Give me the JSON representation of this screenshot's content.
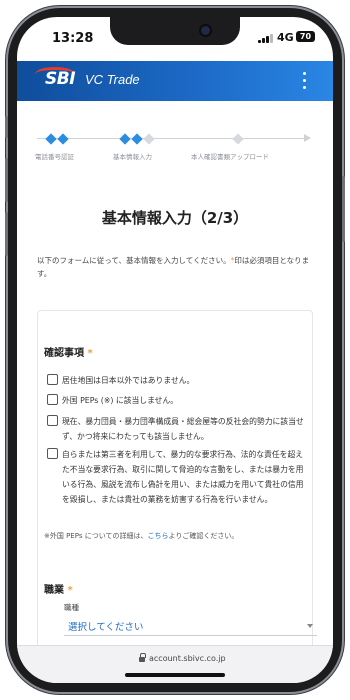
{
  "status_bar": {
    "time": "13:28",
    "network": "4G",
    "battery": "70",
    "signal_icon": "signal-bars-icon"
  },
  "app_bar": {
    "logo_primary": "SBI",
    "logo_secondary": "VC Trade",
    "menu_icon": "more-vertical-icon",
    "colors": {
      "from": "#0f4d9c",
      "to": "#2b86e4",
      "logo_accent": "#e63b2e"
    }
  },
  "stepper": {
    "steps": [
      {
        "label": "電話番号認証",
        "status": "done"
      },
      {
        "label": "基本情報入力",
        "status": "current"
      },
      {
        "label": "本人確認書類アップロード",
        "status": "pending"
      }
    ],
    "colors": {
      "active": "#2a8de0",
      "inactive": "#cfd3d8"
    }
  },
  "page": {
    "title": "基本情報入力（2/3）",
    "intro_before": "以下のフォームに従って、基本情報を入力してください。",
    "intro_star": "*",
    "intro_after": "印は必須項目となります。"
  },
  "confirmation": {
    "title": "確認事項",
    "required_mark": "*",
    "items": [
      "居住地国は日本以外ではありません。",
      "外国 PEPs (※) に該当しません。",
      "現在、暴力団員・暴力団準構成員・総会屋等の反社会的勢力に該当せず、かつ将来にわたっても該当しません。",
      "自らまたは第三者を利用して、暴力的な要求行為、法的な責任を超えた不当な要求行為、取引に関して脅迫的な言動をし、または暴力を用いる行為、風説を流布し偽計を用い、または威力を用いて貴社の信用を毀損し、または貴社の業務を妨害する行為を行いません。"
    ],
    "note_before": "※外国 PEPs についての詳細は、",
    "note_link": "こちら",
    "note_after": "よりご確認ください。"
  },
  "occupation": {
    "title": "職業",
    "required_mark": "*",
    "field_label": "職種",
    "select_placeholder": "選択してください"
  },
  "browser": {
    "url": "account.sbivc.co.jp",
    "lock_icon": "lock-icon"
  }
}
